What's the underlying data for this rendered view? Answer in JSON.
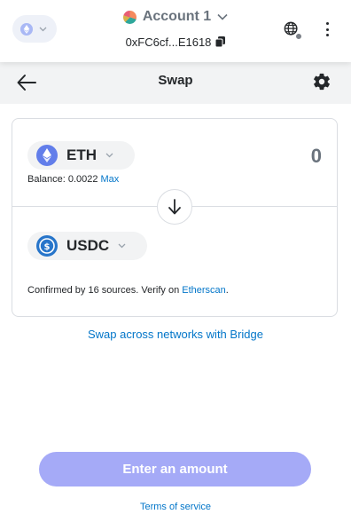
{
  "header": {
    "account_name": "Account 1",
    "address": "0xFC6cf...E1618",
    "network_icon": "ethereum-icon",
    "colors": {
      "network_pill_bg": "#eef1f8"
    }
  },
  "titlebar": {
    "title": "Swap"
  },
  "swap": {
    "from": {
      "symbol": "ETH",
      "icon": "ethereum-icon",
      "amount": "0",
      "balance_label": "Balance: 0.0022",
      "max_label": "Max"
    },
    "to": {
      "symbol": "USDC",
      "icon": "usdc-icon"
    },
    "confirm_text": "Confirmed by 16 sources. Verify on ",
    "etherscan_label": "Etherscan",
    "confirm_suffix": "."
  },
  "bridge_link": "Swap across networks with Bridge",
  "cta_label": "Enter an amount",
  "terms_label": "Terms of service",
  "colors": {
    "link": "#0376c9",
    "cta_disabled": "#a5aaf7",
    "eth": "#627eea",
    "usdc": "#2775ca"
  }
}
